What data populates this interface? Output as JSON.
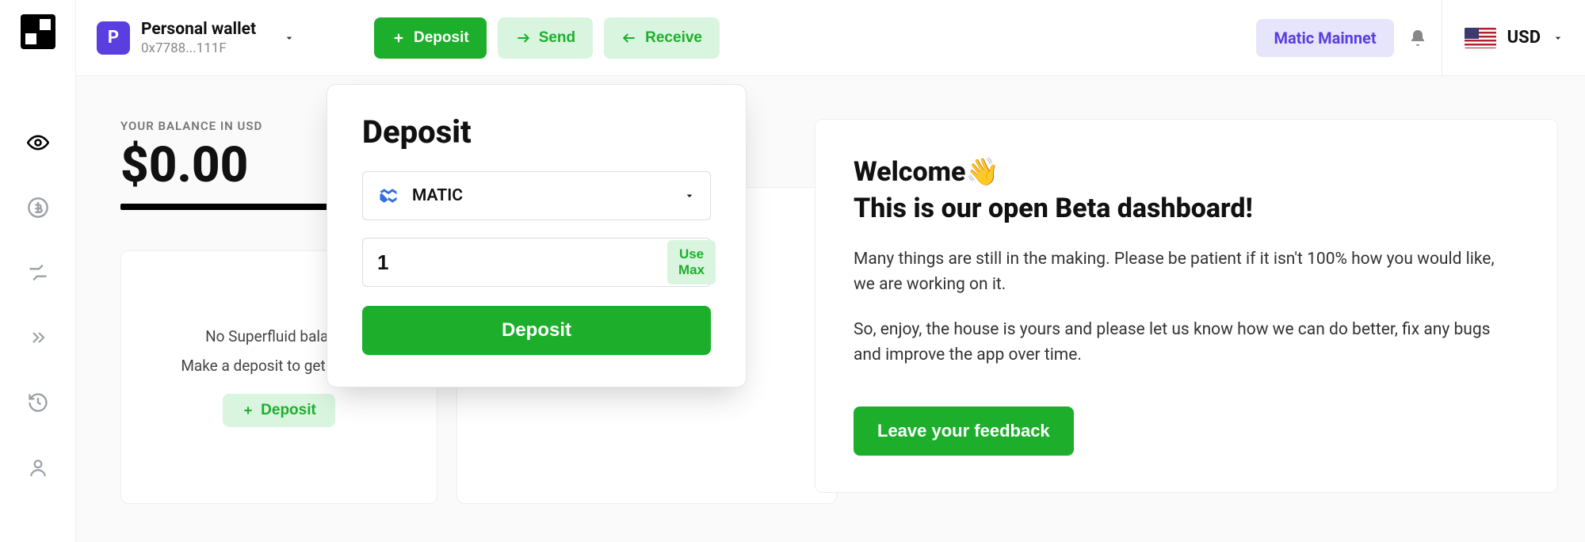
{
  "wallet": {
    "avatar_letter": "P",
    "name": "Personal wallet",
    "address_short": "0x7788...111F"
  },
  "header_buttons": {
    "deposit": "Deposit",
    "send": "Send",
    "receive": "Receive"
  },
  "network_chip": "Matic Mainnet",
  "currency": {
    "code": "USD"
  },
  "balance": {
    "label": "YOUR BALANCE IN USD",
    "value": "$0.00"
  },
  "empty_card": {
    "line1": "No Superfluid balance",
    "line2": "Make a deposit to get started",
    "cta": "Deposit"
  },
  "deposit_panel": {
    "title": "Deposit",
    "token_label": "MATIC",
    "amount_value": "1",
    "use_max": "Use Max",
    "submit": "Deposit"
  },
  "welcome": {
    "line1": "Welcome",
    "line2": "This is our open Beta dashboard!",
    "body1": "Many things are still in the making. Please be patient if it isn't 100% how you would like, we are working on it.",
    "body2": "So, enjoy, the house is yours and please let us know how we can do better, fix any bugs and improve the app over time.",
    "feedback_cta": "Leave your feedback"
  },
  "icons": {
    "eye": "eye-icon",
    "coin": "coin-icon",
    "streams": "streams-icon",
    "chev": "chevrons-icon",
    "history": "history-icon",
    "user": "user-icon"
  }
}
